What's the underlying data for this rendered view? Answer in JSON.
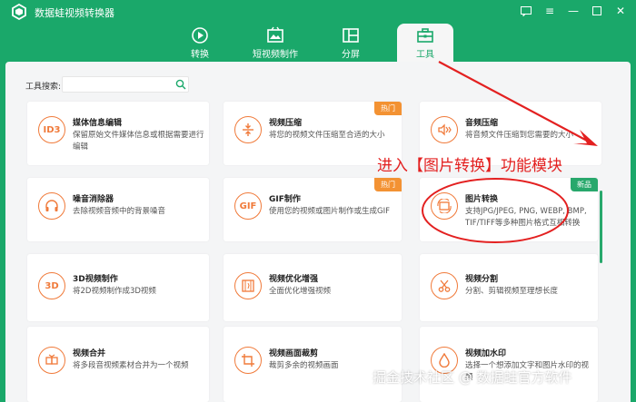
{
  "app": {
    "title": "数据蛙视频转换器"
  },
  "tabs": [
    {
      "label": "转换",
      "icon": "convert-icon"
    },
    {
      "label": "短视频制作",
      "icon": "short-video-icon"
    },
    {
      "label": "分屏",
      "icon": "split-screen-icon"
    },
    {
      "label": "工具",
      "icon": "toolbox-icon",
      "active": true
    }
  ],
  "search": {
    "label": "工具搜索:",
    "value": "",
    "placeholder": ""
  },
  "cards": [
    {
      "title": "媒体信息编辑",
      "desc": "保留原始文件媒体信息或根据需要进行编辑",
      "icon_text": "ID3",
      "badge": ""
    },
    {
      "title": "视频压缩",
      "desc": "将您的视频文件压缩至合适的大小",
      "icon_text": "",
      "badge": "热门"
    },
    {
      "title": "音频压缩",
      "desc": "将音频文件压缩到您需要的大小",
      "icon_text": "",
      "badge": ""
    },
    {
      "title": "噪音消除器",
      "desc": "去除视频音频中的背景噪音",
      "icon_text": "",
      "badge": ""
    },
    {
      "title": "GIF制作",
      "desc": "使用您的视频或图片制作或生成GIF",
      "icon_text": "GIF",
      "badge": "热门"
    },
    {
      "title": "图片转换",
      "desc": "支持JPG/JPEG, PNG, WEBP, BMP, TIF/TIFF等多种图片格式互相转换",
      "icon_text": "",
      "badge": "新品"
    },
    {
      "title": "3D视频制作",
      "desc": "将2D视频制作成3D视频",
      "icon_text": "3D",
      "badge": ""
    },
    {
      "title": "视频优化增强",
      "desc": "全面优化增强视频",
      "icon_text": "",
      "badge": ""
    },
    {
      "title": "视频分割",
      "desc": "分割、剪辑视频至理想长度",
      "icon_text": "",
      "badge": ""
    },
    {
      "title": "视频合并",
      "desc": "将多段音视频素材合并为一个视频",
      "icon_text": "",
      "badge": ""
    },
    {
      "title": "视频画面裁剪",
      "desc": "裁剪多余的视频画面",
      "icon_text": "",
      "badge": ""
    },
    {
      "title": "视频加水印",
      "desc": "选择一个想添加文字和图片水印的视频",
      "icon_text": "",
      "badge": ""
    }
  ],
  "annotation": {
    "text": "进入【图片转换】功能模块"
  },
  "watermark": {
    "text": "掘金技术社区 @ 数据蛙官方软件"
  },
  "colors": {
    "brand": "#1aa86a",
    "accent": "#f07a3a",
    "hot": "#f39233",
    "annotation": "#e32020"
  }
}
